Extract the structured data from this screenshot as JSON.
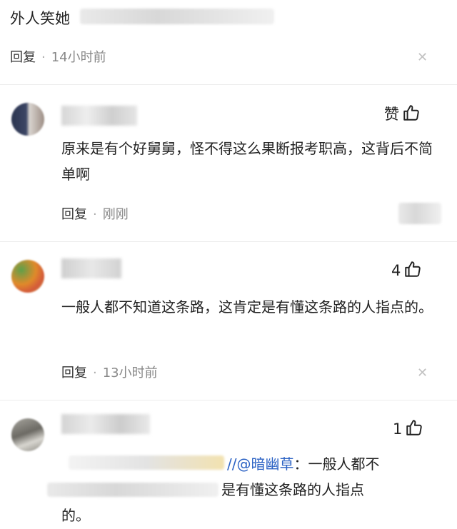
{
  "top": {
    "partial_text": "外人笑她",
    "reply_label": "回复",
    "time": "14小时前"
  },
  "comments": [
    {
      "likes_label": "赞",
      "text": "原来是有个好舅舅，怪不得这么果断报考职高，这背后不简单啊",
      "reply_label": "回复",
      "time": "刚刚"
    },
    {
      "likes_label": "4",
      "text": "一般人都不知道这条路，这肯定是有懂这条路的人指点的。",
      "reply_label": "回复",
      "time": "13小时前"
    },
    {
      "likes_label": "1",
      "mention": "//@暗幽草",
      "quote_line1": "：一般人都不",
      "quote_line2": "是有懂这条路的人指点",
      "quote_line3": "的。"
    }
  ],
  "colors": {
    "mention": "#2b62c4",
    "meta_gray": "#888888",
    "divider": "#ececec"
  },
  "icons": [
    "thumbs-up-icon",
    "close-icon"
  ]
}
